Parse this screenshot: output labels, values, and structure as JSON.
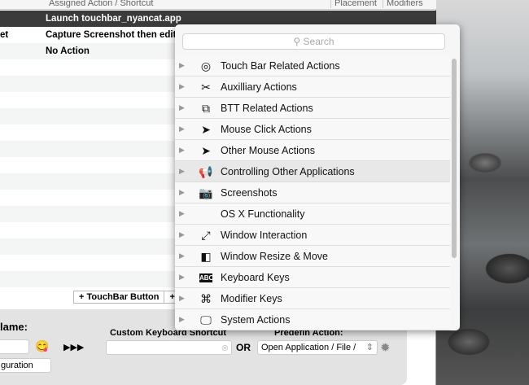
{
  "table": {
    "headers": [
      "Assigned Action / Shortcut",
      "Placement",
      "Modifiers"
    ],
    "rows": [
      {
        "left": "",
        "action": "Launch touchbar_nyancat.app"
      },
      {
        "left": "et",
        "action": "Capture Screenshot then edit i"
      },
      {
        "left": "",
        "action": "No Action"
      }
    ]
  },
  "buttons": {
    "touchbar": "+ TouchBar Button",
    "more": "+"
  },
  "panel": {
    "name_label": "lame:",
    "shortcut_label": "Custom Keyboard Shortcut",
    "or": "OR",
    "predefined_label": "Predefin   Action:",
    "predefined_value": "Open Application / File /",
    "arrows": "▶▶▶",
    "config": "guration",
    "emoji": "😋"
  },
  "popup": {
    "search_placeholder": "Search",
    "items": [
      {
        "label": "Touch Bar Related Actions",
        "icon": "◎"
      },
      {
        "label": "Auxilliary Actions",
        "icon": "✂"
      },
      {
        "label": "BTT Related Actions",
        "icon": "⧉"
      },
      {
        "label": "Mouse Click Actions",
        "icon": "➤"
      },
      {
        "label": "Other Mouse Actions",
        "icon": "➤"
      },
      {
        "label": "Controlling Other Applications",
        "icon": "📢"
      },
      {
        "label": "Screenshots",
        "icon": "📷"
      },
      {
        "label": "OS X Functionality",
        "icon": ""
      },
      {
        "label": "Window Interaction",
        "icon": "⤢"
      },
      {
        "label": "Window Resize & Move",
        "icon": "◧"
      },
      {
        "label": "Keyboard Keys",
        "icon": "ABC"
      },
      {
        "label": "Modifier Keys",
        "icon": "⌘"
      },
      {
        "label": "System Actions",
        "icon": "🖵"
      }
    ]
  }
}
